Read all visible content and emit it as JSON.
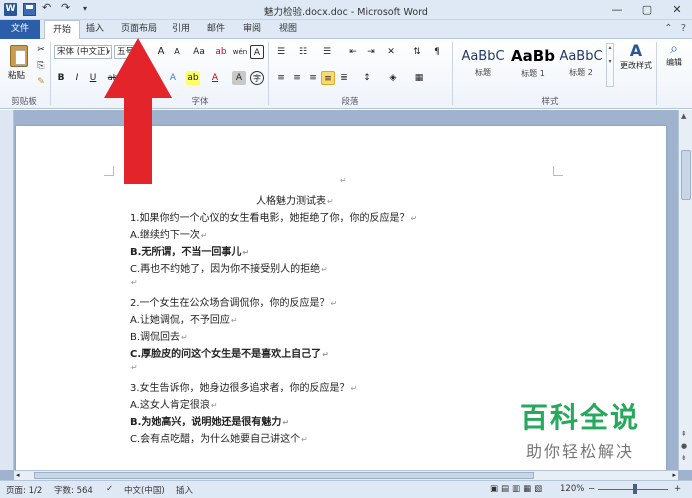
{
  "window": {
    "title": "魅力检验.docx.doc - Microsoft Word",
    "app_icon_letter": "W"
  },
  "tabs": [
    "文件",
    "开始",
    "插入",
    "页面布局",
    "引用",
    "邮件",
    "审阅",
    "视图"
  ],
  "active_tab": "开始",
  "ribbon": {
    "clipboard": {
      "paste_label": "粘贴",
      "group_label": "剪贴板"
    },
    "font": {
      "font_name": "宋体 (中文正)",
      "font_size": "五号",
      "grow": "A",
      "shrink": "A",
      "change_case": "Aa",
      "clear_format": "ab",
      "phonetic": "wén",
      "border_char": "A",
      "bold": "B",
      "italic": "I",
      "underline": "U",
      "strike": "abc",
      "subscript": "x₂",
      "superscript": "x²",
      "highlight": "ab",
      "font_color": "A",
      "char_shading": "A",
      "enclose": "字",
      "group_label": "字体"
    },
    "paragraph": {
      "group_label": "段落"
    },
    "styles": {
      "items": [
        {
          "sample": "AaBbC",
          "name": "标题"
        },
        {
          "sample": "AaBb",
          "name": "标题 1"
        },
        {
          "sample": "AaBbC",
          "name": "标题 2"
        }
      ],
      "change_styles": "更改样式",
      "group_label": "样式"
    },
    "editing": {
      "label": "编辑"
    }
  },
  "document": {
    "lines": [
      {
        "text": "人格魅力测试表",
        "bold": false,
        "center": true
      },
      {
        "text": "1.如果你约一个心仪的女生看电影，她拒绝了你，你的反应是？",
        "bold": false
      },
      {
        "text": "A.继续约下一次",
        "bold": false
      },
      {
        "text": "B.无所谓，不当一回事儿",
        "bold": true
      },
      {
        "text": "C.再也不约她了，因为你不接受别人的拒绝",
        "bold": false
      },
      {
        "text": "",
        "bold": false
      },
      {
        "text": "2.一个女生在公众场合调侃你，你的反应是？",
        "bold": false
      },
      {
        "text": "A.让她调侃，不予回应",
        "bold": false
      },
      {
        "text": "B.调侃回去",
        "bold": false
      },
      {
        "text": "C.厚脸皮的问这个女生是不是喜欢上自己了",
        "bold": true
      },
      {
        "text": "",
        "bold": false
      },
      {
        "text": "3.女生告诉你，她身边很多追求者，你的反应是？",
        "bold": false
      },
      {
        "text": "A.这女人肯定很浪",
        "bold": false
      },
      {
        "text": "B.为她高兴，说明她还是很有魅力",
        "bold": true
      },
      {
        "text": "C.会有点吃醋，为什么她要自己讲这个",
        "bold": false
      }
    ],
    "paragraph_mark": "↵"
  },
  "status": {
    "page": "页面: 1/2",
    "words": "字数: 564",
    "language": "中文(中国)",
    "mode": "插入",
    "zoom": "120%"
  },
  "watermark": {
    "title": "百科全说",
    "subtitle": "助你轻松解决"
  },
  "colors": {
    "file_tab": "#2b5ea9",
    "arrow": "#e3242b",
    "watermark_green": "#26a95c"
  }
}
